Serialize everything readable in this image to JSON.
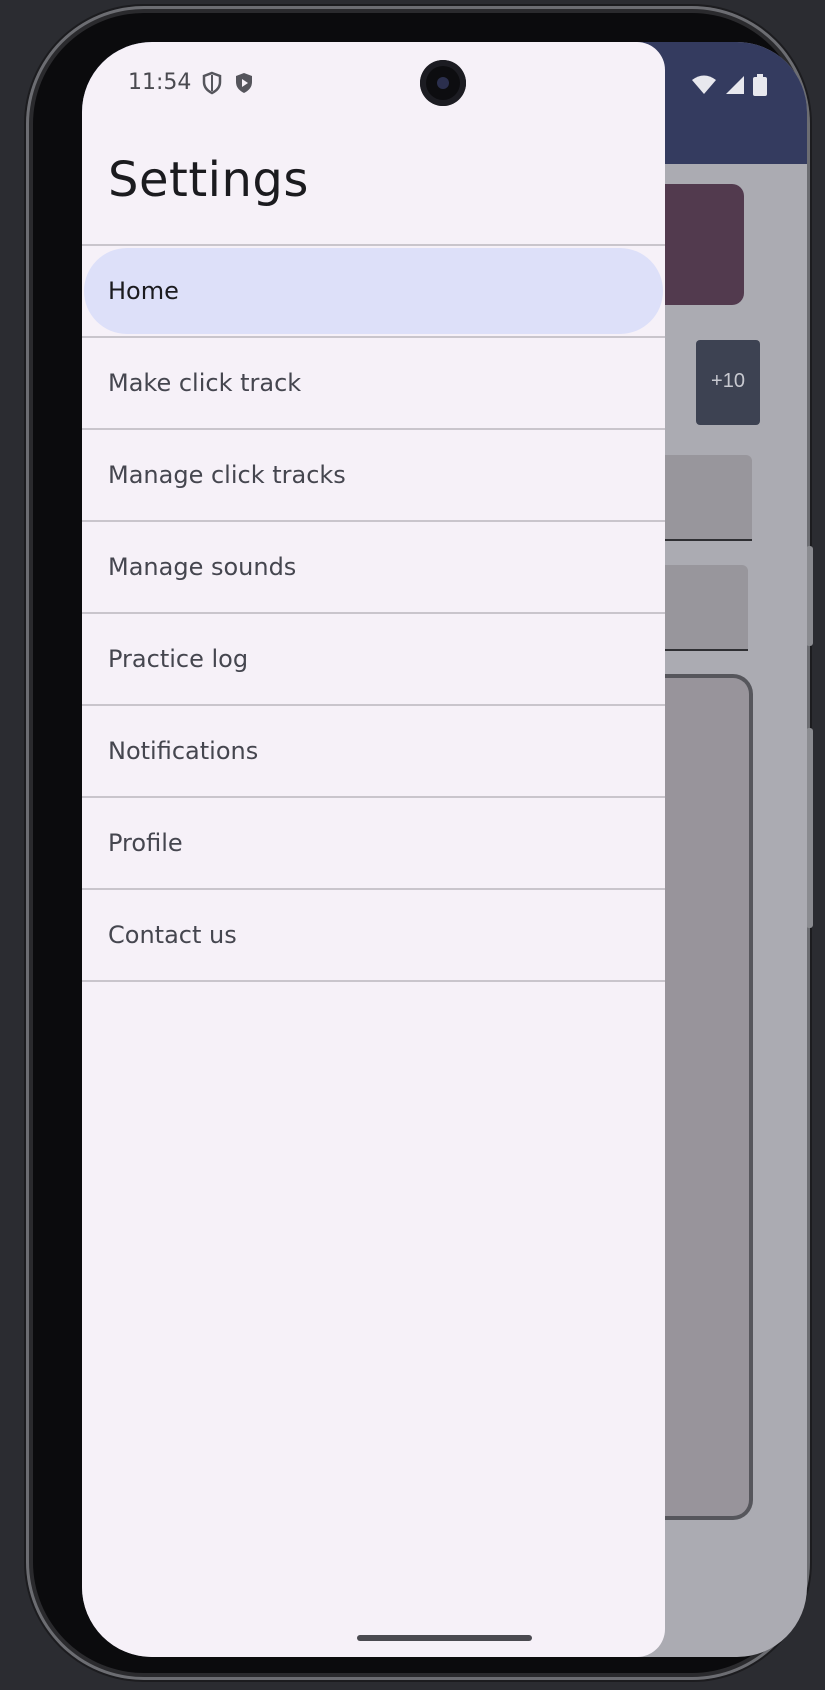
{
  "status_bar": {
    "time": "11:54",
    "left_icons": [
      "shield-outline-icon",
      "shield-play-icon"
    ],
    "right_icons": [
      "wifi-icon",
      "cellular-signal-icon",
      "battery-icon"
    ]
  },
  "background_app": {
    "stepper_button_label": "+10"
  },
  "drawer": {
    "title": "Settings",
    "items": [
      {
        "label": "Home",
        "active": true
      },
      {
        "label": "Make click track",
        "active": false
      },
      {
        "label": "Manage click tracks",
        "active": false
      },
      {
        "label": "Manage sounds",
        "active": false
      },
      {
        "label": "Practice log",
        "active": false
      },
      {
        "label": "Notifications",
        "active": false
      },
      {
        "label": "Profile",
        "active": false
      },
      {
        "label": "Contact us",
        "active": false
      }
    ]
  },
  "colors": {
    "drawer_background": "#f6f1f8",
    "active_item_background": "#dde0f9",
    "app_topbar": "#343b5f"
  }
}
